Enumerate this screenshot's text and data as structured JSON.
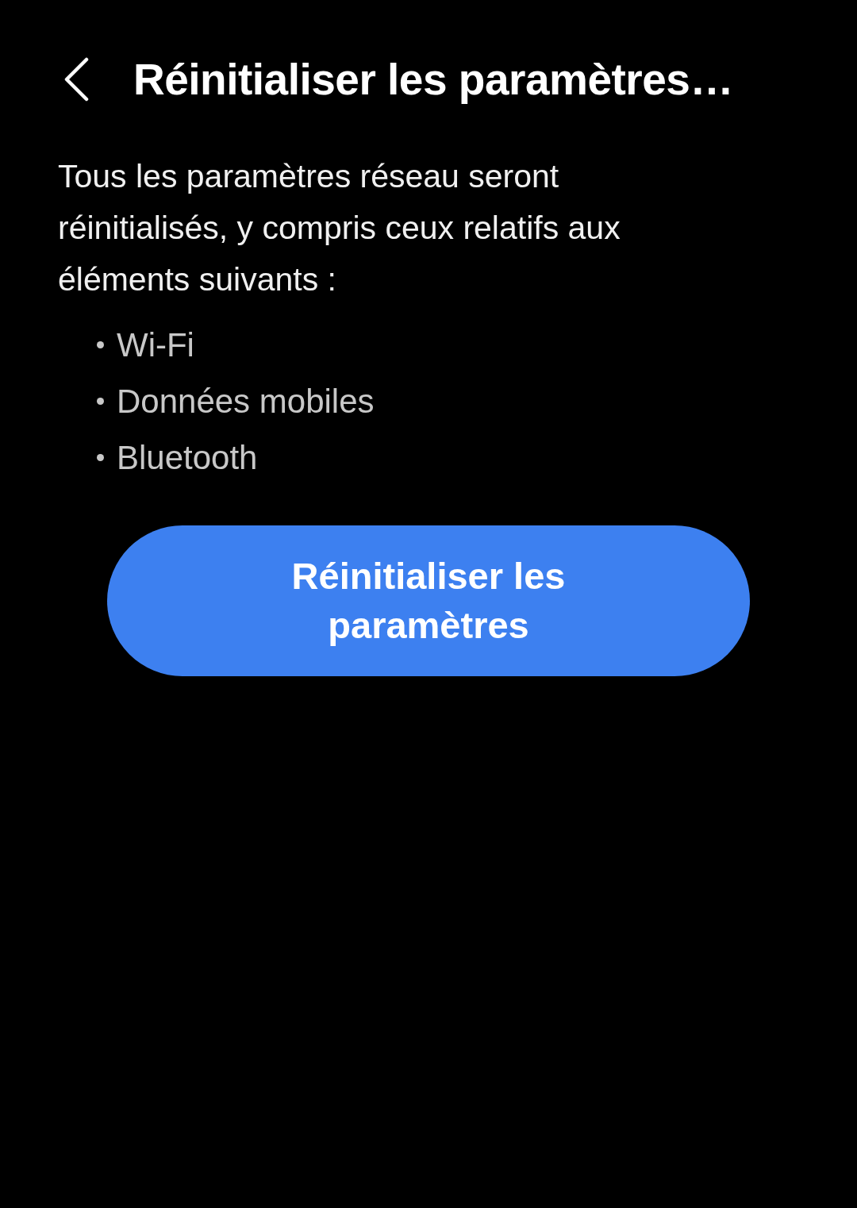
{
  "header": {
    "title": "Réinitialiser les paramètres…"
  },
  "description": "Tous les paramètres réseau seront réinitialisés, y compris ceux relatifs aux éléments suivants :",
  "items": [
    "Wi-Fi",
    "Données mobiles",
    "Bluetooth"
  ],
  "button": {
    "label": "Réinitialiser les paramètres"
  }
}
